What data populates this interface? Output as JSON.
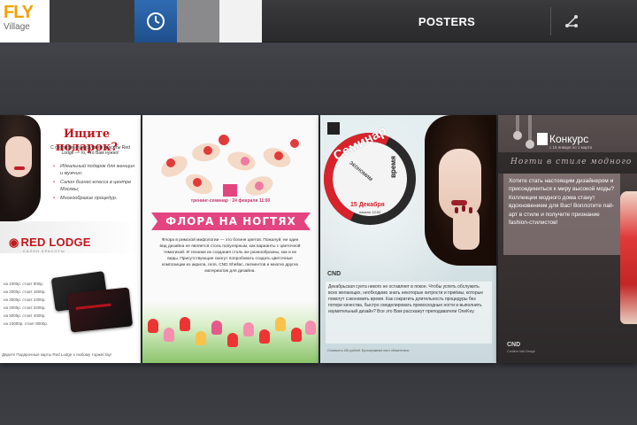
{
  "header": {
    "logo_line1": "FLY",
    "logo_line2": "Village",
    "title": "POSTERS",
    "clock_icon": "clock-icon",
    "share_icon": "share-icon"
  },
  "colors": {
    "logo_orange": "#f2a100",
    "clock_blue": "#2f6cb3",
    "accent_red": "#c0191f",
    "accent_pink": "#e2457f"
  },
  "posters": [
    {
      "heading": "Ищите подарок?",
      "sub": "С сертификатом салонов красоты Red Lodge — то, что Вам нужно!",
      "bullets": [
        "Идеальный подарок для женщин и мужчин;",
        "Салон бизнес-класса в центре Москвы;",
        "Многообразие процедур."
      ],
      "brand": "RED LODGE",
      "brand_sub": "САЛОН КРАСОТЫ",
      "prices": [
        "на 1000р. стоит 800р.",
        "на 2000р. стоит 1600р.",
        "на 3000р. стоит 2400р.",
        "на 4000р. стоит 3200р.",
        "на 5000р. стоит 4000р.",
        "на 10000р. стоит 8000р."
      ],
      "footer": "Дарите Подарочные карты Red Lodge к любому торжеству!"
    },
    {
      "event": "тренинг-семинар · 24 февраля 11:00",
      "title": "ФЛОРА НА НОГТЯХ",
      "body": "Флора в римской мифологии — это богиня цветов. Пожалуй, ни один вид дизайна не является столь популярным, как варианты с цветочной тематикой. И техники их создания столь же разнообразны, как и их виды. Присутствующие смогут попробовать создать цветочные композиции из акрила, геля, CND Shellac, пигментов и многих других материалов для дизайна."
    },
    {
      "seminar": "Семинар",
      "econ": "экономим",
      "time": "время",
      "date": "15 Декабря",
      "date_sub": "начало 10:00",
      "brand": "CND",
      "body": "Декабрьская суета никого не оставляет в покое. Чтобы успеть обслужить всех желающих, необходимо знать некоторые хитрости и приёмы, которые помогут сэкономить время. Как сократить длительность процедуры без потери качества, быстро смоделировать превосходные ногти и выполнить изумительный дизайн? Все это Вам расскажут преподаватели OneKey.",
      "small": "Стоимость 150 рублей. Бронирование мест обязательно."
    },
    {
      "title": "Конкурс",
      "date": "с 15 января по 1 марта",
      "stage": "Ногти в стиле модного",
      "body": "Хотите стать настоящим дизайнером и присоединиться к миру высокой моды? Коллекции модного дома станут вдохновением для Вас! Воплотите nail-арт в стиле и получите признание fashion-стилистов!",
      "brand": "CND",
      "brand_sub": "Creative Nail Design"
    }
  ]
}
